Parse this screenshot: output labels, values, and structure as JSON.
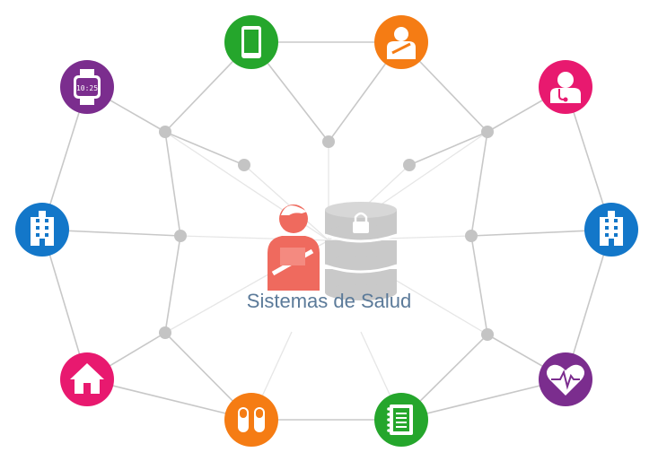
{
  "diagram": {
    "title": "Sistemas de Salud",
    "center_icons": [
      "patient-arm-sling-icon",
      "database-lock-icon"
    ],
    "nodes": [
      {
        "name": "smartwatch",
        "icon": "smartwatch-icon",
        "color": "#7b2d8e",
        "watch_text": "10:25"
      },
      {
        "name": "mobile-phone",
        "icon": "mobile-phone-icon",
        "color": "#25a62c"
      },
      {
        "name": "injured-patient",
        "icon": "injured-patient-icon",
        "color": "#f57c14"
      },
      {
        "name": "doctor",
        "icon": "doctor-stethoscope-icon",
        "color": "#e8196f"
      },
      {
        "name": "hospital-left",
        "icon": "hospital-building-icon",
        "color": "#1377c9"
      },
      {
        "name": "hospital-right",
        "icon": "hospital-building-icon",
        "color": "#1377c9"
      },
      {
        "name": "home",
        "icon": "home-icon",
        "color": "#e8196f"
      },
      {
        "name": "pills",
        "icon": "pills-icon",
        "color": "#f57c14"
      },
      {
        "name": "medical-record",
        "icon": "medical-record-notebook-icon",
        "color": "#25a62c"
      },
      {
        "name": "heart-monitor",
        "icon": "heart-rate-icon",
        "color": "#7b2d8e"
      }
    ],
    "colors": {
      "line": "#c8c8c8",
      "dot": "#c4c4c4",
      "patient": "#ef6a5e",
      "database": "#c9c9c9",
      "caption": "#5b7a99"
    }
  }
}
